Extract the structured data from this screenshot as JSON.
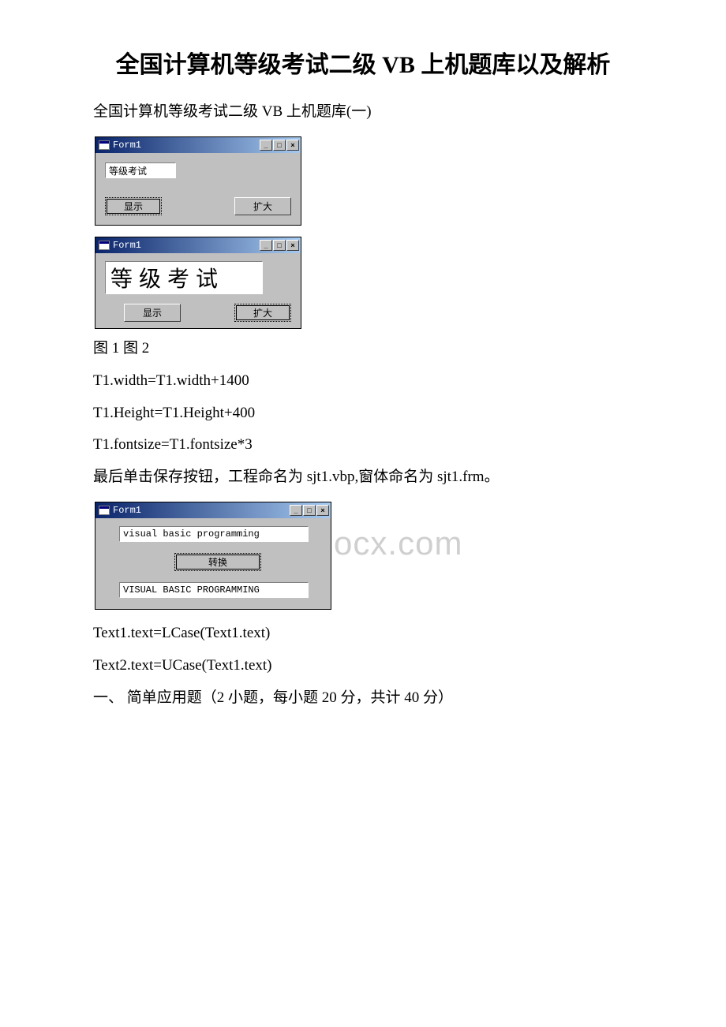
{
  "title": "全国计算机等级考试二级 VB 上机题库以及解析",
  "subtitle": "全国计算机等级考试二级 VB 上机题库(一)",
  "watermark": "www.bdocx.com",
  "window1": {
    "title": "Form1",
    "textbox": "等级考试",
    "btn_show": "显示",
    "btn_enlarge": "扩大"
  },
  "window2": {
    "title": "Form1",
    "textbox": "等级考试",
    "btn_show": "显示",
    "btn_enlarge": "扩大"
  },
  "window3": {
    "title": "Form1",
    "textbox1": "visual basic programming",
    "btn_convert": "转换",
    "textbox2": "VISUAL BASIC PROGRAMMING"
  },
  "caption12": "图 1 图 2",
  "code1": "T1.width=T1.width+1400",
  "code2": "T1.Height=T1.Height+400",
  "code3": "T1.fontsize=T1.fontsize*3",
  "note1": "最后单击保存按钮，工程命名为 sjt1.vbp,窗体命名为 sjt1.frm。",
  "code4": "Text1.text=LCase(Text1.text)",
  "code5": "Text2.text=UCase(Text1.text)",
  "section": "一、 简单应用题（2 小题，每小题 20 分，共计 40 分）",
  "win_btns": {
    "min": "_",
    "max": "□",
    "close": "×"
  }
}
